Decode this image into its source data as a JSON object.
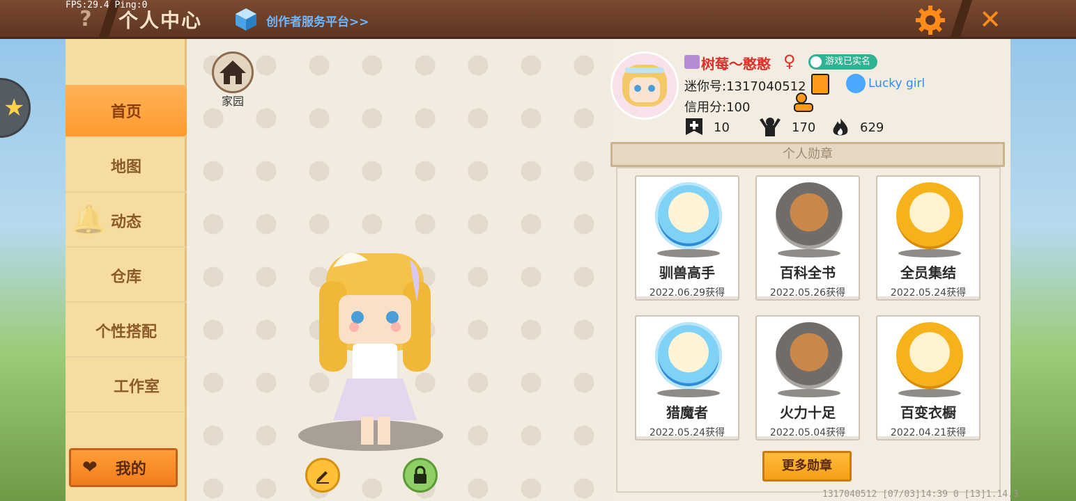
{
  "debug": {
    "fps": "FPS:29.4  Ping:0"
  },
  "header": {
    "title": "个人中心",
    "creator_link": "创作者服务平台>>",
    "help_symbol": "?",
    "close_symbol": "✕"
  },
  "sidebar": {
    "items": [
      {
        "label": "首页",
        "active": true
      },
      {
        "label": "地图",
        "active": false
      },
      {
        "label": "动态",
        "active": false
      },
      {
        "label": "仓库",
        "active": false
      },
      {
        "label": "个性搭配",
        "active": false
      },
      {
        "label": "工作室",
        "active": false
      }
    ],
    "mine_label": "我的"
  },
  "character": {
    "home_label": "家园"
  },
  "profile": {
    "nickname": "树莓～憨憨",
    "realname_badge": "游戏已实名",
    "uid": "迷你号:1317040512",
    "title": "Lucky girl",
    "credit": "信用分:100",
    "stats": {
      "friends": "10",
      "fans": "170",
      "heat": "629"
    }
  },
  "medals": {
    "heading": "个人勋章",
    "items": [
      {
        "name": "驯兽高手",
        "date": "2022.06.29获得",
        "tier": "blue"
      },
      {
        "name": "百科全书",
        "date": "2022.05.26获得",
        "tier": "gray"
      },
      {
        "name": "全员集结",
        "date": "2022.05.24获得",
        "tier": "gold"
      },
      {
        "name": "猎魔者",
        "date": "2022.05.24获得",
        "tier": "blue"
      },
      {
        "name": "火力十足",
        "date": "2022.05.04获得",
        "tier": "gray"
      },
      {
        "name": "百变衣橱",
        "date": "2022.04.21获得",
        "tier": "gold"
      }
    ],
    "more_label": "更多勋章"
  },
  "footer": {
    "debug_line": "1317040512    [07/03]14:39 0  [13]1.14.3"
  },
  "colors": {
    "accent": "#ff9a2e",
    "nickname": "#e0302a",
    "link": "#6fb8ff"
  }
}
